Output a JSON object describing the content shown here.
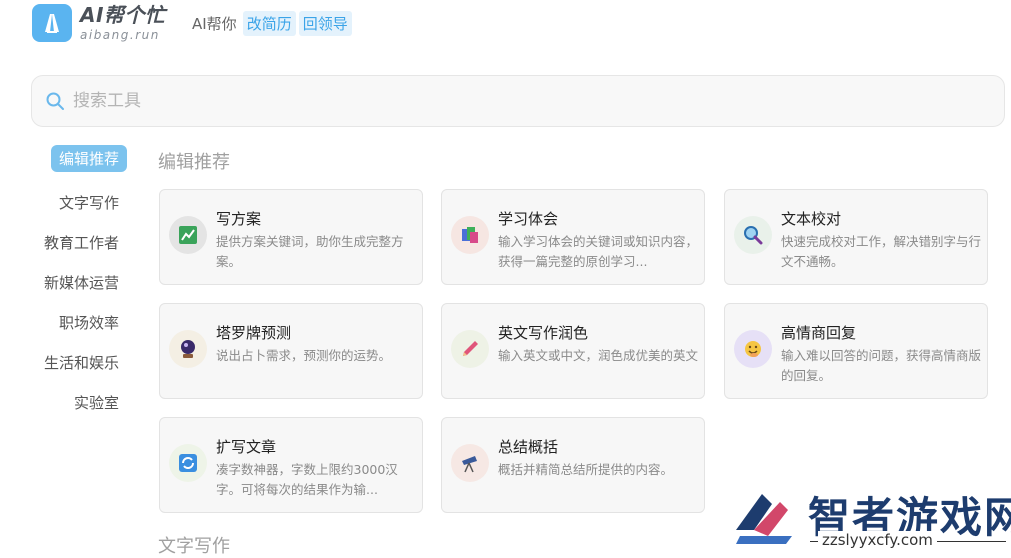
{
  "header": {
    "logo_title": "AI帮个忙",
    "logo_subtitle": "aibang.run",
    "nav_text": "AI帮你",
    "nav_chips": [
      "改简历",
      "回领导"
    ]
  },
  "search": {
    "placeholder": "搜索工具",
    "value": ""
  },
  "sidebar": {
    "items": [
      {
        "label": "编辑推荐",
        "active": true
      },
      {
        "label": "文字写作"
      },
      {
        "label": "教育工作者"
      },
      {
        "label": "新媒体运营"
      },
      {
        "label": "职场效率"
      },
      {
        "label": "生活和娱乐"
      },
      {
        "label": "实验室"
      }
    ]
  },
  "sections": [
    {
      "title": "编辑推荐",
      "cards": [
        {
          "title": "写方案",
          "desc": "提供方案关键词，助你生成完整方案。",
          "icon": "chart-board-icon"
        },
        {
          "title": "学习体会",
          "desc": "输入学习体会的关键词或知识内容，获得一篇完整的原创学习...",
          "icon": "books-icon"
        },
        {
          "title": "文本校对",
          "desc": "快速完成校对工作，解决错别字与行文不通畅。",
          "icon": "magnifier-icon"
        },
        {
          "title": "塔罗牌预测",
          "desc": "说出占卜需求，预测你的运势。",
          "icon": "crystal-ball-icon"
        },
        {
          "title": "英文写作润色",
          "desc": "输入英文或中文，润色成优美的英文",
          "icon": "pen-icon"
        },
        {
          "title": "高情商回复",
          "desc": "输入难以回答的问题，获得高情商版的回复。",
          "icon": "smile-face-icon"
        },
        {
          "title": "扩写文章",
          "desc": "凑字数神器，字数上限约3000汉字。可将每次的结果作为输...",
          "icon": "refresh-icon"
        },
        {
          "title": "总结概括",
          "desc": "概括并精简总结所提供的内容。",
          "icon": "telescope-icon"
        }
      ]
    },
    {
      "title": "文字写作"
    }
  ],
  "watermark": {
    "text": "智者游戏网",
    "url": "zzslyyxcfy.com"
  }
}
